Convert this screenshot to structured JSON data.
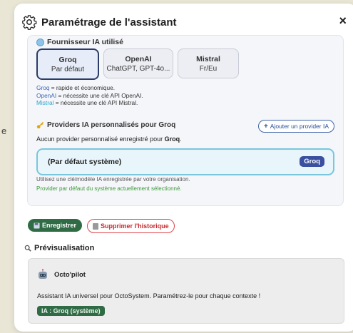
{
  "background_fragment": "e",
  "modal": {
    "title": "Paramétrage de l'assistant",
    "close": "×"
  },
  "provider_section": {
    "heading": "Fournisseur IA utilisé",
    "options": [
      {
        "name": "Groq",
        "sub": "Par défaut",
        "selected": true
      },
      {
        "name": "OpenAI",
        "sub": "ChatGPT, GPT-4o...",
        "selected": false
      },
      {
        "name": "Mistral",
        "sub": "Fr/Eu",
        "selected": false
      }
    ],
    "notes": {
      "groq_name": "Groq",
      "groq_text": " = rapide et économique.",
      "openai_name": "OpenAI",
      "openai_text": " = nécessite une clé API OpenAI.",
      "mistral_name": "Mistral",
      "mistral_text": " = nécessite une clé API Mistral."
    }
  },
  "custom_section": {
    "heading": "Providers IA personnalisés pour Groq",
    "add_button": "Ajouter un provider IA",
    "none_prefix": "Aucun provider personnalisé enregistré pour ",
    "none_provider": "Groq",
    "none_suffix": ".",
    "default_label": "(Par défaut système)",
    "default_badge": "Groq",
    "hint_line1": "Utilisez une clé/modèle IA enregistrée par votre organisation.",
    "hint_line2": "Provider par défaut du système actuellement sélectionné."
  },
  "actions": {
    "save": "Enregistrer",
    "clear_history": "Supprimer l'historique"
  },
  "preview": {
    "heading": "Prévisualisation",
    "bot_name": "Octo'pilot",
    "description": "Assistant IA universel pour OctoSystem. Paramétrez-le pour chaque contexte !",
    "tag": "IA : Groq (système)"
  },
  "colors": {
    "accent_green": "#2f6b44",
    "accent_blue": "#3a4fa0",
    "danger": "#e0454a",
    "highlight_border": "#79c6dd"
  }
}
